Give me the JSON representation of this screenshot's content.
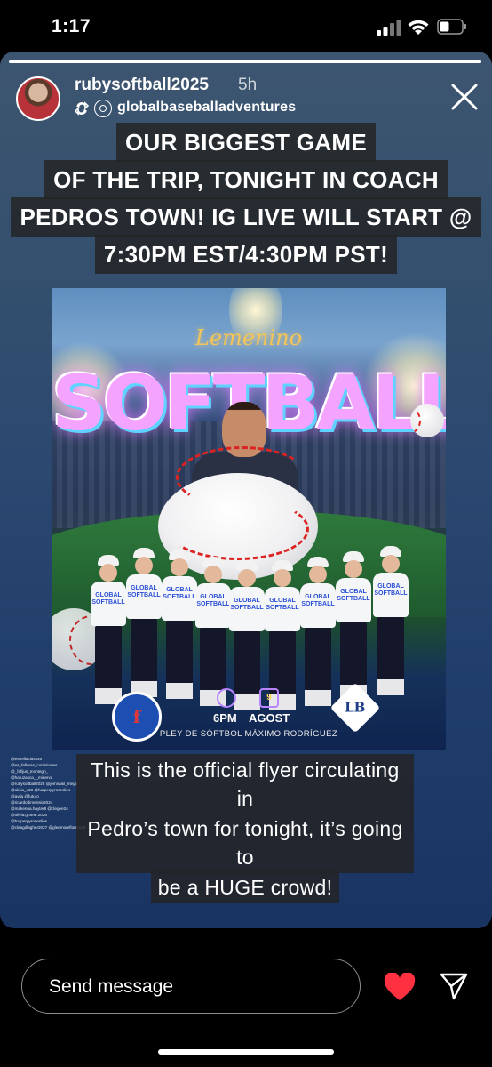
{
  "status_bar": {
    "time": "1:17"
  },
  "story": {
    "username": "rubysoftball2025",
    "time_ago": "5h",
    "reposted_from": "globalbaseballadventures",
    "progress": 1.0,
    "caption_lines": [
      "OUR BIGGEST GAME",
      "OF THE TRIP, TONIGHT IN COACH",
      "PEDROS TOWN! IG LIVE WILL START @",
      "7:30PM EST/4:30PM PST!"
    ],
    "flyer": {
      "script_title": "Lemenino",
      "title": "SOFTBALL",
      "time": "6PM",
      "day": "9",
      "month": "AGOST",
      "venue": "PLEY DE SÓFTBOL MÁXIMO RODRÍGUEZ",
      "left_logo_text": "f",
      "right_logo_text": "LB",
      "jersey_text": "GLOBAL SOFTBALL"
    },
    "mentions": [
      "@estrellaclass46",
      "@es_fefimas_comisiones",
      "@_fafijus_montegn_",
      "@haruzasca__minerva",
      "@rubysoftball2025 @jemnasil_mega",
      "@alicia_x33 @harperpyroseslies",
      "@avila @futuro___",
      "@ricardodimensio2024",
      "@makenna.hayter8 @clegee24",
      "@olivia.groete.2026",
      "@harperpyroseslies",
      "@claagdlagher2027 @gleemoreflorres26"
    ],
    "caption2_lines": [
      "This is the official flyer circulating in",
      "Pedro’s town for tonight, it’s going to",
      "be a HUGE crowd!"
    ]
  },
  "reply_bar": {
    "placeholder": "Send message"
  },
  "colors": {
    "heart": "#ff3040",
    "caption_bg": "#232323"
  }
}
